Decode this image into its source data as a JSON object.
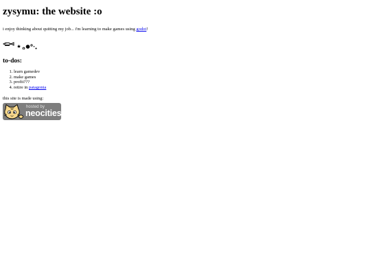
{
  "header": {
    "title": "zysymu: the website :o"
  },
  "intro": {
    "text_before_link": "i enjoy thinking about quitting my job... i'm learning to make games using ",
    "link_text": "godot",
    "text_after_link": "!"
  },
  "doodle": {
    "icon": "fish-and-stars-doodle-icon"
  },
  "todos": {
    "heading": "to-dos:",
    "items": [
      {
        "text": "learn gamedev"
      },
      {
        "text": "make games"
      },
      {
        "text": "profit???"
      },
      {
        "text": "retire in ",
        "link_text": "patagonia"
      }
    ]
  },
  "footer": {
    "made_using": "this site is made using:",
    "badge": {
      "hosted_by": "hosted by",
      "brand": "neocities",
      "icon": "neocities-cat-icon",
      "background_color": "#7e7e7e"
    }
  },
  "colors": {
    "link": "#0000ee",
    "text": "#000000",
    "background": "#ffffff"
  }
}
